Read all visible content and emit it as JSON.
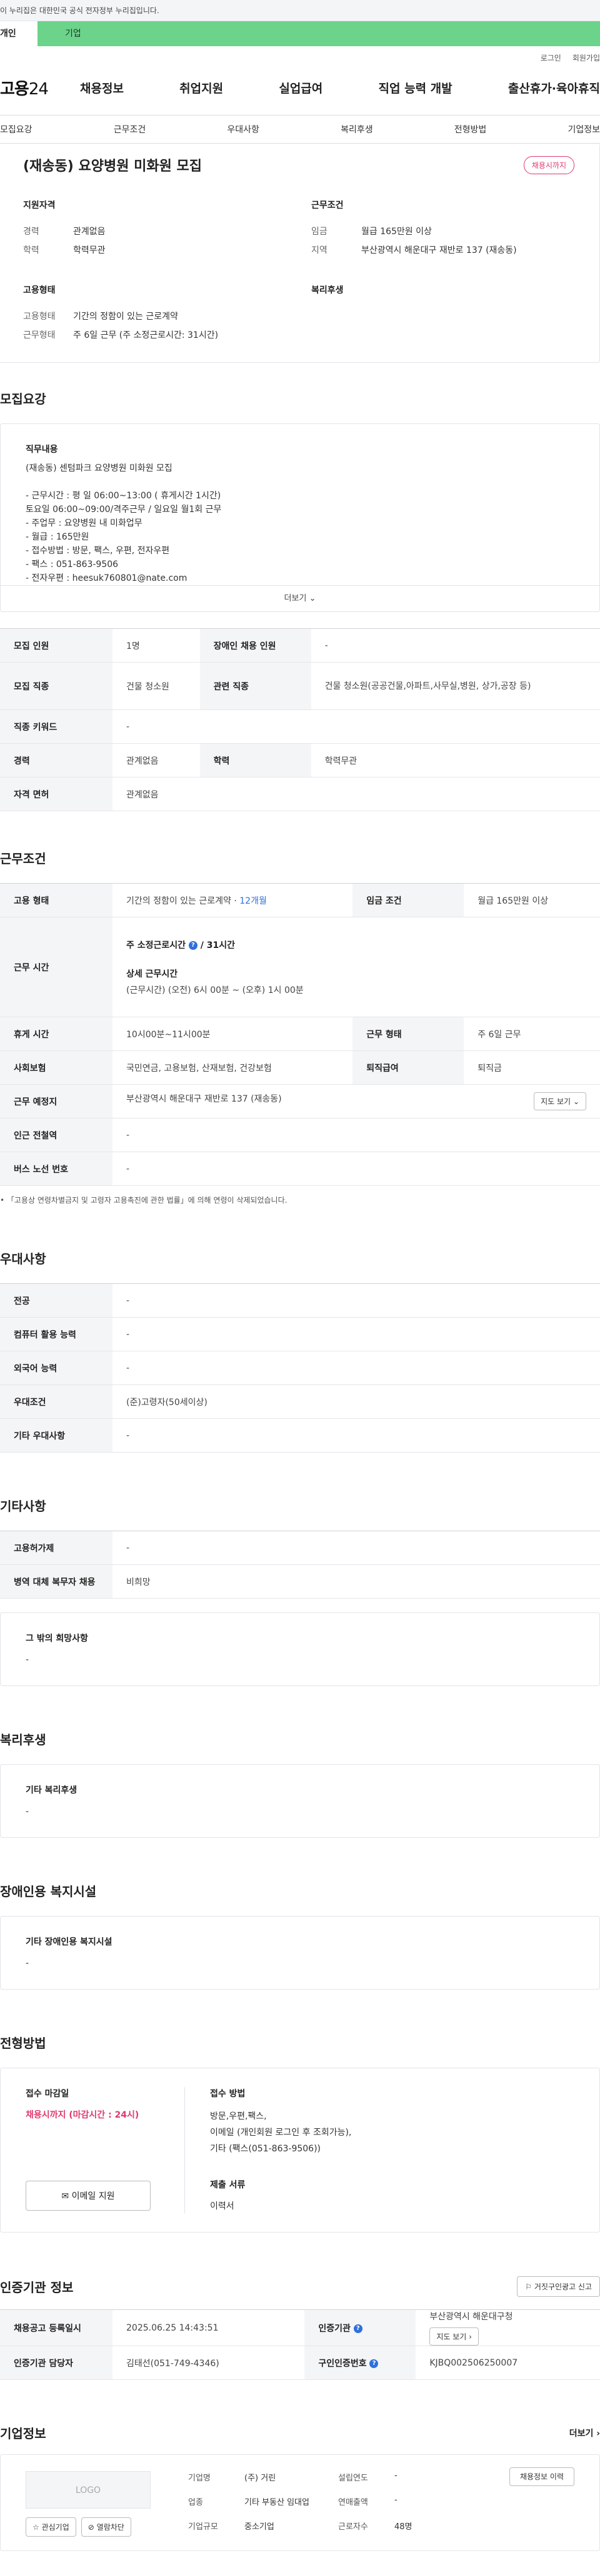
{
  "banner": {
    "text": "이 누리집은 대한민국 공식 전자정부 누리집입니다."
  },
  "user_tabs": {
    "personal": "개인",
    "company": "기업"
  },
  "util": {
    "login": "로그인",
    "signup": "회원가입"
  },
  "logo": {
    "text_main": "고용",
    "text_num": "24"
  },
  "gnb": [
    "채용정보",
    "취업지원",
    "실업급여",
    "직업 능력 개발",
    "출산휴가·육아휴직"
  ],
  "anchors": [
    "모집요강",
    "근무조건",
    "우대사항",
    "복리후생",
    "전형방법",
    "기업정보"
  ],
  "job": {
    "title": "(재송동) 요양병원 미화원 모집",
    "deadline_badge": "채용시까지"
  },
  "summary": {
    "qual_title": "지원자격",
    "career_k": "경력",
    "career_v": "관계없음",
    "edu_k": "학력",
    "edu_v": "학력무관",
    "cond_title": "근무조건",
    "wage_k": "임금",
    "wage_v": "월급 165만원 이상",
    "region_k": "지역",
    "region_v": "부산광역시 해운대구 재반로 137 (재송동)",
    "emp_title": "고용형태",
    "emp_type_k": "고용형태",
    "emp_type_v": "기간의 정함이 있는 근로계약",
    "work_type_k": "근무형태",
    "work_type_v": "주 6일 근무 (주 소정근로시간: 31시간)",
    "welfare_title": "복리후생"
  },
  "recruit": {
    "section": "모집요강",
    "duty_head": "직무내용",
    "duty_text": "(재송동) 센텀파크 요양병원 미화원 모집\n\n- 근무시간 : 평   일 06:00~13:00 ( 휴게시간 1시간)\n                 토요일 06:00~09:00/격주근무 / 일요일 월1회 근무\n- 주업무 : 요양병원 내 미화업무\n- 월급 : 165만원\n- 접수방법 : 방문, 팩스, 우편, 전자우편\n- 팩스 : 051-863-9506\n- 전자우편 : heesuk760801@nate.com",
    "more": "더보기",
    "rows": [
      {
        "k1": "모집 인원",
        "v1": "1명",
        "k2": "장애인 채용 인원",
        "v2": "-"
      },
      {
        "k1": "모집 직종",
        "v1": "건물 청소원",
        "k2": "관련 직종",
        "v2": "건물 청소원(공공건물,아파트,사무실,병원, 상가,공장 등)"
      },
      {
        "k1": "직종 키워드",
        "v1": "-"
      },
      {
        "k1": "경력",
        "v1": "관계없음",
        "k2": "학력",
        "v2": "학력무관"
      },
      {
        "k1": "자격 면허",
        "v1": "관계없음"
      }
    ]
  },
  "conditions": {
    "section": "근무조건",
    "emp_k": "고용 형태",
    "emp_v": "기간의 정함이 있는 근로계약 · ",
    "emp_period": "12개월",
    "wage_k": "임금 조건",
    "wage_v": "월급 165만원 이상",
    "hours_k": "근무 시간",
    "hours_week": "주 소정근로시간",
    "hours_week_val": "31시간",
    "hours_detail_head": "상세 근무시간",
    "hours_detail": "(근무시간) (오전) 6시 00분 ~ (오후) 1시 00분",
    "break_k": "휴게 시간",
    "break_v": "10시00분~11시00분",
    "worktype_k": "근무 형태",
    "worktype_v": "주 6일 근무",
    "insurance_k": "사회보험",
    "insurance_v": "국민연금, 고용보험, 산재보험, 건강보험",
    "retire_k": "퇴직급여",
    "retire_v": "퇴직금",
    "place_k": "근무 예정지",
    "place_v": "부산광역시 해운대구 재반로 137 (재송동)",
    "map_btn": "지도 보기",
    "subway_k": "인근 전철역",
    "subway_v": "-",
    "bus_k": "버스 노선 번호",
    "bus_v": "-",
    "note": "• 「고용상 연령차별금지 및 고령자 고용촉진에 관한 법률」에 의해 연령이 삭제되었습니다."
  },
  "preferences": {
    "section": "우대사항",
    "rows": [
      {
        "k": "전공",
        "v": "-"
      },
      {
        "k": "컴퓨터 활용 능력",
        "v": "-"
      },
      {
        "k": "외국어 능력",
        "v": "-"
      },
      {
        "k": "우대조건",
        "v": "(준)고령자(50세이상)"
      },
      {
        "k": "기타 우대사항",
        "v": "-"
      }
    ]
  },
  "etc": {
    "section": "기타사항",
    "rows": [
      {
        "k": "고용허가제",
        "v": "-"
      },
      {
        "k": "병역 대체 복무자 채용",
        "v": "비희망"
      }
    ],
    "hope_head": "그 밖의 희망사항",
    "hope_v": "-"
  },
  "welfare": {
    "section": "복리후생",
    "head": "기타 복리후생",
    "v": "-"
  },
  "disabled": {
    "section": "장애인용 복지시설",
    "head": "기타 장애인용 복지시설",
    "v": "-"
  },
  "screening": {
    "section": "전형방법",
    "deadline_head": "접수 마감일",
    "deadline_v": "채용시까지 (마감시간 : 24시)",
    "mail_btn": "이메일 지원",
    "method_head": "접수 방법",
    "method_v": "방문,우편,팩스,\n이메일 (개인회원 로그인 후 조회가능),\n기타 (팩스(051-863-9506))",
    "docs_head": "제출 서류",
    "docs_v": "이력서"
  },
  "cert": {
    "section": "인증기관 정보",
    "report_btn": "거짓구인광고 신고",
    "reg_k": "채용공고 등록일시",
    "reg_v": "2025.06.25 14:43:51",
    "org_k": "인증기관",
    "org_v": "부산광역시 해운대구청",
    "map_btn": "지도 보기",
    "manager_k": "인증기관 담당자",
    "manager_v": "김태선(051-749-4346)",
    "certno_k": "구인인증번호",
    "certno_v": "KJBQ002506250007"
  },
  "company": {
    "section": "기업정보",
    "more": "더보기",
    "logo": "LOGO",
    "fav_btn": "관심기업",
    "block_btn": "열람차단",
    "name_k": "기업명",
    "name_v": "(주) 거린",
    "industry_k": "업종",
    "industry_v": "기타 부동산 임대업",
    "size_k": "기업규모",
    "size_v": "중소기업",
    "founded_k": "설립연도",
    "founded_v": "-",
    "sales_k": "연매출액",
    "sales_v": "-",
    "staff_k": "근로자수",
    "staff_v": "48명",
    "jobs_btn": "채용정보 이력"
  }
}
